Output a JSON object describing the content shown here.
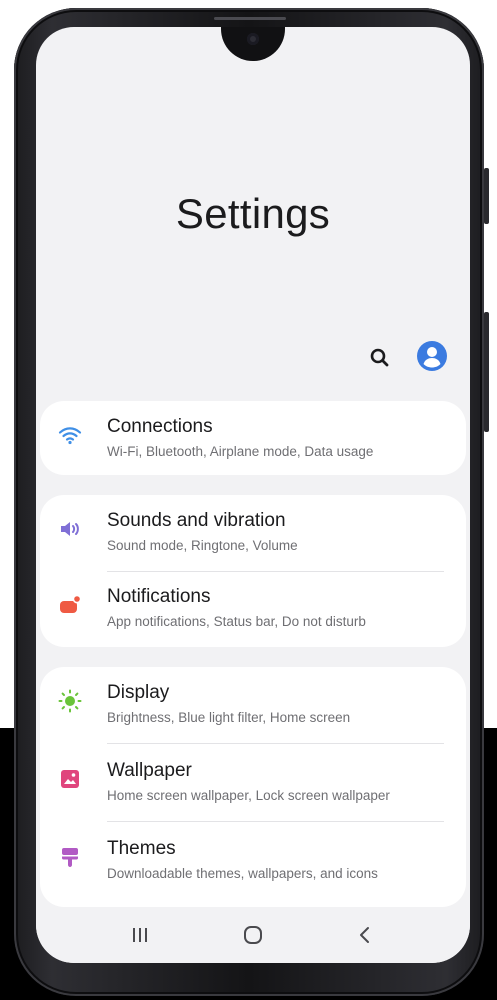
{
  "header": {
    "title": "Settings"
  },
  "actions": {
    "search_icon": "search-icon",
    "account_icon": "account-icon",
    "accent_color": "#3b7be0"
  },
  "groups": [
    {
      "items": [
        {
          "title": "Connections",
          "subtitle": "Wi-Fi, Bluetooth, Airplane mode, Data usage",
          "icon": "wifi-icon",
          "icon_color": "#3f8fe6"
        }
      ]
    },
    {
      "items": [
        {
          "title": "Sounds and vibration",
          "subtitle": "Sound mode, Ringtone, Volume",
          "icon": "volume-icon",
          "icon_color": "#7f6fd6"
        },
        {
          "title": "Notifications",
          "subtitle": "App notifications, Status bar, Do not disturb",
          "icon": "notification-icon",
          "icon_color": "#ef5a43"
        }
      ]
    },
    {
      "items": [
        {
          "title": "Display",
          "subtitle": "Brightness, Blue light filter, Home screen",
          "icon": "brightness-icon",
          "icon_color": "#6ac43a"
        },
        {
          "title": "Wallpaper",
          "subtitle": "Home screen wallpaper, Lock screen wallpaper",
          "icon": "wallpaper-icon",
          "icon_color": "#e0457d"
        },
        {
          "title": "Themes",
          "subtitle": "Downloadable themes, wallpapers, and icons",
          "icon": "themes-icon",
          "icon_color": "#b15ac4"
        }
      ]
    }
  ],
  "navbar": {
    "recents_icon": "recents-icon",
    "home_icon": "home-icon",
    "back_icon": "back-icon"
  }
}
